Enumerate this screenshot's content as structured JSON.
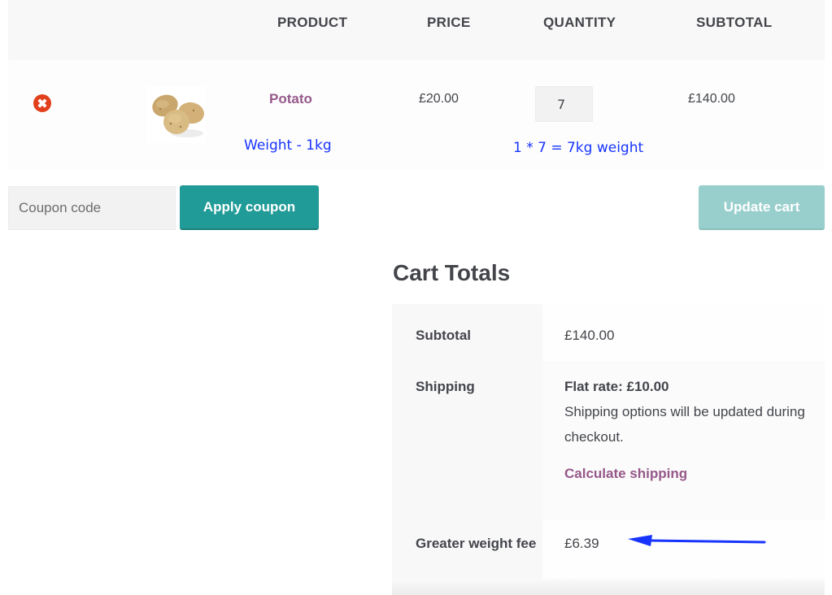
{
  "cart": {
    "columns": {
      "product": "PRODUCT",
      "price": "PRICE",
      "quantity": "QUANTITY",
      "subtotal": "SUBTOTAL"
    },
    "items": [
      {
        "name": "Potato",
        "weight_note": "Weight - 1kg",
        "price": "£20.00",
        "quantity": "7",
        "quantity_note": "1 * 7 = 7kg weight",
        "subtotal": "£140.00",
        "remove_icon": "remove-circle-x-icon",
        "image": "potato-thumbnail"
      }
    ]
  },
  "actions": {
    "coupon_placeholder": "Coupon code",
    "coupon_value": "",
    "apply_coupon_label": "Apply coupon",
    "update_cart_label": "Update cart"
  },
  "totals": {
    "title": "Cart Totals",
    "subtotal_label": "Subtotal",
    "subtotal_value": "£140.00",
    "shipping_label": "Shipping",
    "shipping_method": "Flat rate: £10.00",
    "shipping_note": "Shipping options will be updated during checkout.",
    "calculate_shipping_label": "Calculate shipping",
    "fee_label": "Greater weight fee",
    "fee_value": "£6.39"
  },
  "annotation": {
    "arrow_icon": "left-arrow-annotation",
    "color": "#1734ff"
  },
  "colors": {
    "accent_button": "#219b97",
    "accent_button_disabled": "#98cfcd",
    "link_purple": "#96588a",
    "remove_red": "#e2401c",
    "annotation_blue": "#1734ff"
  }
}
